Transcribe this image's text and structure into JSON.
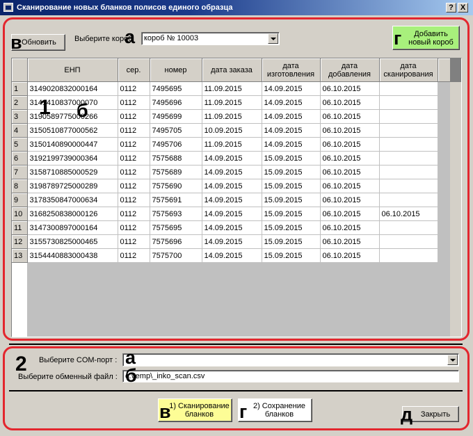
{
  "window": {
    "title": "Сканирование новых бланков полисов единого образца",
    "help_btn": "?",
    "close_btn": "X"
  },
  "section1": {
    "marker_number": "1",
    "markers": {
      "refresh": "в",
      "select_box": "а",
      "add_box": "г",
      "row_marker_1": "1",
      "row_marker_b": "б"
    },
    "refresh_label": "Обновить",
    "select_box_label": "Выберите короб",
    "select_box_value": "короб № 10003",
    "add_box_label": "Добавить новый короб",
    "columns": [
      "ЕНП",
      "сер.",
      "номер",
      "дата заказа",
      "дата изготовления",
      "дата добавления",
      "дата сканирования"
    ],
    "rows": [
      {
        "n": "1",
        "enp": "3149020832000164",
        "ser": "0112",
        "num": "7495695",
        "order": "11.09.2015",
        "made": "14.09.2015",
        "added": "06.10.2015",
        "scanned": ""
      },
      {
        "n": "2",
        "enp": "3141410837000070",
        "ser": "0112",
        "num": "7495696",
        "order": "11.09.2015",
        "made": "14.09.2015",
        "added": "06.10.2015",
        "scanned": ""
      },
      {
        "n": "3",
        "enp": "3190589775000266",
        "ser": "0112",
        "num": "7495699",
        "order": "11.09.2015",
        "made": "14.09.2015",
        "added": "06.10.2015",
        "scanned": ""
      },
      {
        "n": "4",
        "enp": "3150510877000562",
        "ser": "0112",
        "num": "7495705",
        "order": "10.09.2015",
        "made": "14.09.2015",
        "added": "06.10.2015",
        "scanned": ""
      },
      {
        "n": "5",
        "enp": "3150140890000447",
        "ser": "0112",
        "num": "7495706",
        "order": "11.09.2015",
        "made": "14.09.2015",
        "added": "06.10.2015",
        "scanned": ""
      },
      {
        "n": "6",
        "enp": "3192199739000364",
        "ser": "0112",
        "num": "7575688",
        "order": "14.09.2015",
        "made": "15.09.2015",
        "added": "06.10.2015",
        "scanned": ""
      },
      {
        "n": "7",
        "enp": "3158710885000529",
        "ser": "0112",
        "num": "7575689",
        "order": "14.09.2015",
        "made": "15.09.2015",
        "added": "06.10.2015",
        "scanned": ""
      },
      {
        "n": "8",
        "enp": "3198789725000289",
        "ser": "0112",
        "num": "7575690",
        "order": "14.09.2015",
        "made": "15.09.2015",
        "added": "06.10.2015",
        "scanned": ""
      },
      {
        "n": "9",
        "enp": "3178350847000634",
        "ser": "0112",
        "num": "7575691",
        "order": "14.09.2015",
        "made": "15.09.2015",
        "added": "06.10.2015",
        "scanned": ""
      },
      {
        "n": "10",
        "enp": "3168250838000126",
        "ser": "0112",
        "num": "7575693",
        "order": "14.09.2015",
        "made": "15.09.2015",
        "added": "06.10.2015",
        "scanned": "06.10.2015"
      },
      {
        "n": "11",
        "enp": "3147300897000164",
        "ser": "0112",
        "num": "7575695",
        "order": "14.09.2015",
        "made": "15.09.2015",
        "added": "06.10.2015",
        "scanned": ""
      },
      {
        "n": "12",
        "enp": "3155730825000465",
        "ser": "0112",
        "num": "7575696",
        "order": "14.09.2015",
        "made": "15.09.2015",
        "added": "06.10.2015",
        "scanned": ""
      },
      {
        "n": "13",
        "enp": "3154440883000438",
        "ser": "0112",
        "num": "7575700",
        "order": "14.09.2015",
        "made": "15.09.2015",
        "added": "06.10.2015",
        "scanned": ""
      }
    ]
  },
  "section2": {
    "marker_number": "2",
    "markers": {
      "com_port": "а",
      "exchange_file": "б",
      "scan": "в",
      "save": "г",
      "close": "д"
    },
    "com_port_label": "Выберите COM-порт :",
    "com_port_value": "",
    "exchange_file_label": "Выберите обменный файл :",
    "exchange_file_value": "c:\\temp\\_inko_scan.csv",
    "scan_label": "1) Сканирование бланков",
    "save_label": "2) Сохранение бланков",
    "close_label": "Закрыть"
  },
  "colors": {
    "red_outline": "#e3262e",
    "add_button": "#a8f07c",
    "scan_button": "#fdfd96",
    "titlebar": "#0a246a"
  }
}
